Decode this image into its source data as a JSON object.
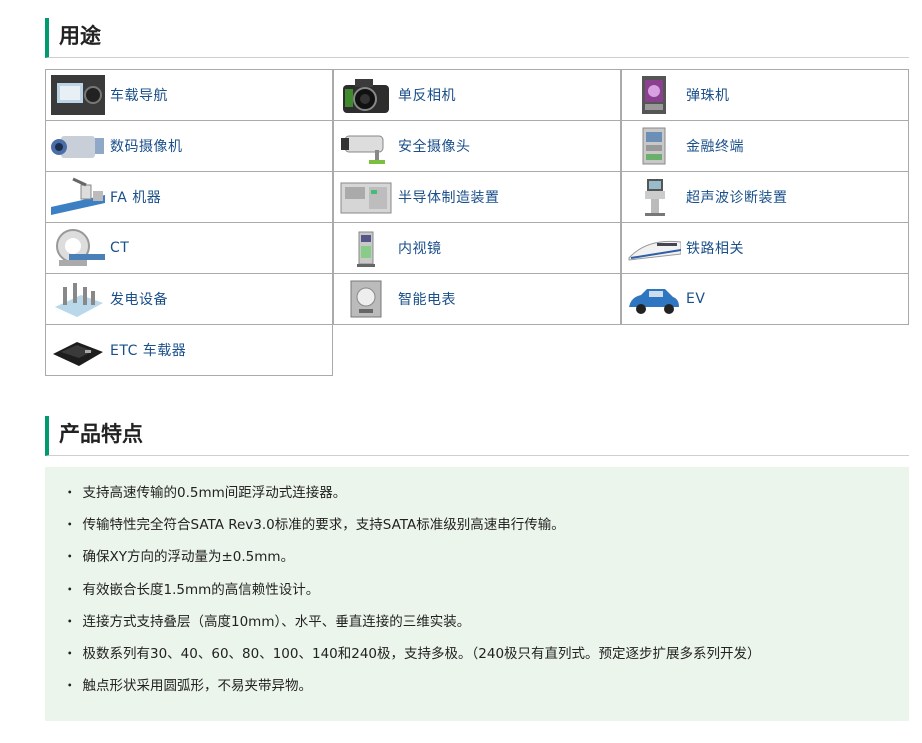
{
  "section1": {
    "title": "用途"
  },
  "section2": {
    "title": "产品特点"
  },
  "applications": [
    {
      "label": "车载导航",
      "icon": "car-navigation-icon"
    },
    {
      "label": "单反相机",
      "icon": "dslr-camera-icon"
    },
    {
      "label": "弹珠机",
      "icon": "pachinko-machine-icon"
    },
    {
      "label": "数码摄像机",
      "icon": "video-camera-icon"
    },
    {
      "label": "安全摄像头",
      "icon": "security-camera-icon"
    },
    {
      "label": "金融终端",
      "icon": "financial-terminal-icon"
    },
    {
      "label": "FA 机器",
      "icon": "fa-robot-icon"
    },
    {
      "label": "半导体制造装置",
      "icon": "semiconductor-equipment-icon"
    },
    {
      "label": "超声波诊断装置",
      "icon": "ultrasound-device-icon"
    },
    {
      "label": "CT",
      "icon": "ct-scanner-icon"
    },
    {
      "label": "内视镜",
      "icon": "endoscope-icon"
    },
    {
      "label": "铁路相关",
      "icon": "bullet-train-icon"
    },
    {
      "label": "发电设备",
      "icon": "power-generation-icon"
    },
    {
      "label": "智能电表",
      "icon": "smart-meter-icon"
    },
    {
      "label": "EV",
      "icon": "ev-car-icon"
    },
    {
      "label": "ETC 车载器",
      "icon": "etc-device-icon"
    }
  ],
  "features": [
    "支持高速传输的0.5mm间距浮动式连接器。",
    "传输特性完全符合SATA Rev3.0标准的要求，支持SATA标准级别高速串行传输。",
    "确保XY方向的浮动量为±0.5mm。",
    "有效嵌合长度1.5mm的高信赖性设计。",
    "连接方式支持叠层（高度10mm）、水平、垂直连接的三维实装。",
    "极数系列有30、40、60、80、100、140和240极，支持多极。（240极只有直列式。预定逐步扩展多系列开发）",
    "触点形状采用圆弧形，不易夹带异物。"
  ],
  "bullet": "・",
  "colors": {
    "accent": "#009a6e",
    "link": "#1a4f8a",
    "feature_bg": "#ecf5ec"
  }
}
